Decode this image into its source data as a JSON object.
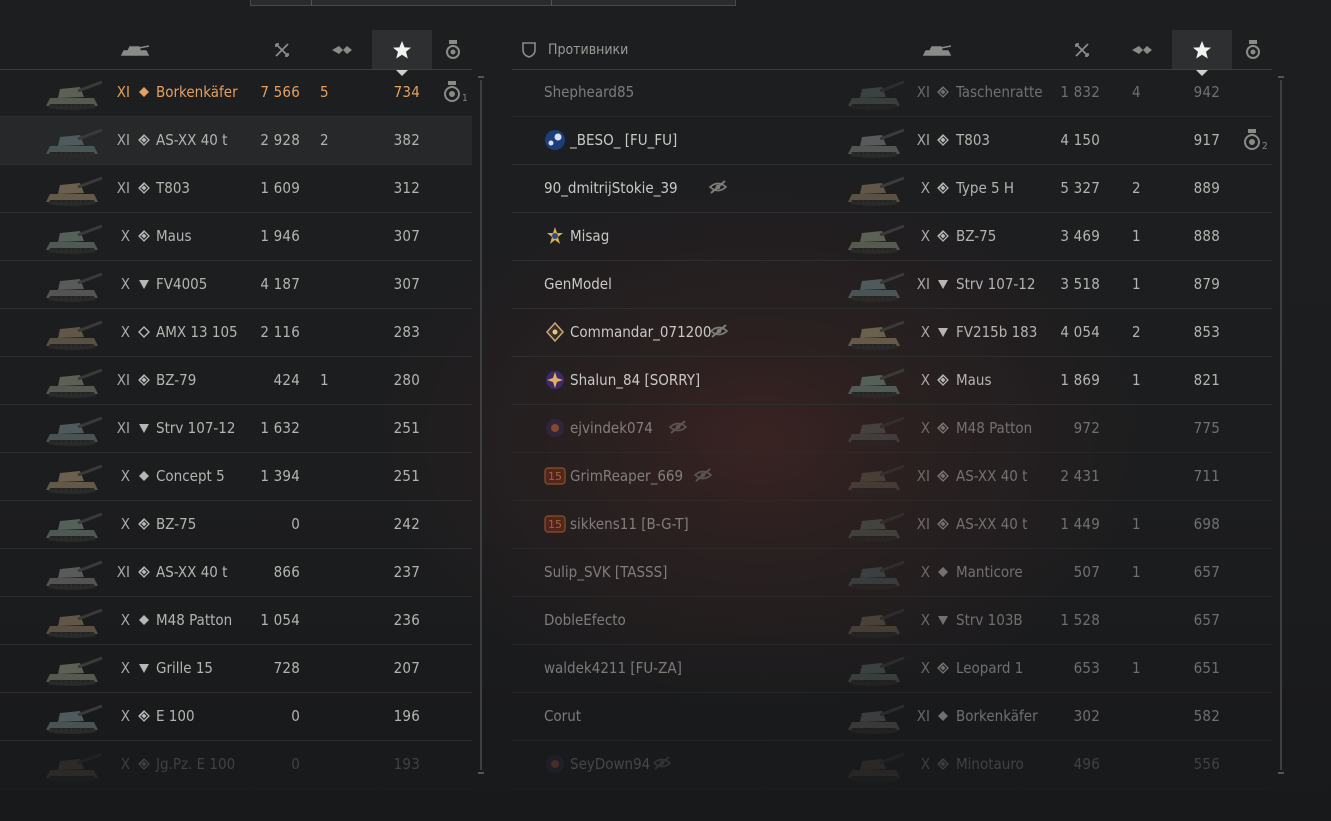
{
  "headers": {
    "enemies_label": "Противники",
    "cols": [
      "tank-icon",
      "frags-icon",
      "damage-icon",
      "xp-star-icon",
      "medal-icon"
    ]
  },
  "left_team": [
    {
      "tier": "XI",
      "cls": "med",
      "vehicle": "Borkenkäfer",
      "damage": "7 566",
      "frags": "5",
      "xp": "734",
      "medal": "1",
      "me": true
    },
    {
      "tier": "XI",
      "cls": "hvy",
      "vehicle": "AS-XX 40 t",
      "damage": "2 928",
      "frags": "2",
      "xp": "382",
      "hl": true
    },
    {
      "tier": "XI",
      "cls": "hvy",
      "vehicle": "T803",
      "damage": "1 609",
      "frags": "",
      "xp": "312"
    },
    {
      "tier": "X",
      "cls": "hvy",
      "vehicle": "Maus",
      "damage": "1 946",
      "frags": "",
      "xp": "307"
    },
    {
      "tier": "X",
      "cls": "td",
      "vehicle": "FV4005",
      "damage": "4 187",
      "frags": "",
      "xp": "307"
    },
    {
      "tier": "X",
      "cls": "lt",
      "vehicle": "AMX 13 105",
      "damage": "2 116",
      "frags": "",
      "xp": "283"
    },
    {
      "tier": "XI",
      "cls": "hvy",
      "vehicle": "BZ-79",
      "damage": "424",
      "frags": "1",
      "xp": "280"
    },
    {
      "tier": "XI",
      "cls": "td",
      "vehicle": "Strv 107-12",
      "damage": "1 632",
      "frags": "",
      "xp": "251"
    },
    {
      "tier": "X",
      "cls": "med",
      "vehicle": "Concept 5",
      "damage": "1 394",
      "frags": "",
      "xp": "251"
    },
    {
      "tier": "X",
      "cls": "hvy",
      "vehicle": "BZ-75",
      "damage": "0",
      "frags": "",
      "xp": "242"
    },
    {
      "tier": "XI",
      "cls": "hvy",
      "vehicle": "AS-XX 40 t",
      "damage": "866",
      "frags": "",
      "xp": "237"
    },
    {
      "tier": "X",
      "cls": "med",
      "vehicle": "M48 Patton",
      "damage": "1 054",
      "frags": "",
      "xp": "236"
    },
    {
      "tier": "X",
      "cls": "td",
      "vehicle": "Grille 15",
      "damage": "728",
      "frags": "",
      "xp": "207"
    },
    {
      "tier": "X",
      "cls": "hvy",
      "vehicle": "E 100",
      "damage": "0",
      "frags": "",
      "xp": "196"
    },
    {
      "tier": "X",
      "cls": "hvy",
      "vehicle": "Jg.Pz. E 100",
      "damage": "0",
      "frags": "",
      "xp": "193",
      "fade": 2
    }
  ],
  "right_team": [
    {
      "player": "Shepheard85",
      "tier": "XI",
      "cls": "hvy",
      "vehicle": "Taschenratte",
      "damage": "1 832",
      "frags": "4",
      "xp": "942",
      "fade": 1
    },
    {
      "player": "_BESO_ [FU_FU]",
      "badge": "steam",
      "tier": "XI",
      "cls": "hvy",
      "vehicle": "T803",
      "damage": "4 150",
      "frags": "",
      "xp": "917",
      "medal": "2"
    },
    {
      "player": "90_dmitrijStokie_39",
      "hidden": true,
      "tier": "X",
      "cls": "hvy",
      "vehicle": "Type 5 H",
      "damage": "5 327",
      "frags": "2",
      "xp": "889"
    },
    {
      "player": "Misag",
      "badge": "gold",
      "tier": "X",
      "cls": "hvy",
      "vehicle": "BZ-75",
      "damage": "3 469",
      "frags": "1",
      "xp": "888"
    },
    {
      "player": "GenModel",
      "tier": "XI",
      "cls": "td",
      "vehicle": "Strv 107-12",
      "damage": "3 518",
      "frags": "1",
      "xp": "879"
    },
    {
      "player": "Commandar_071200",
      "badge": "diamond",
      "hidden": true,
      "tier": "X",
      "cls": "td",
      "vehicle": "FV215b 183",
      "damage": "4 054",
      "frags": "2",
      "xp": "853"
    },
    {
      "player": "Shalun_84 [SORRY]",
      "badge": "purple",
      "tier": "X",
      "cls": "hvy",
      "vehicle": "Maus",
      "damage": "1 869",
      "frags": "1",
      "xp": "821"
    },
    {
      "player": "ejvindek074",
      "badge": "orb",
      "hidden": true,
      "tier": "X",
      "cls": "hvy",
      "vehicle": "M48 Patton",
      "damage": "972",
      "frags": "",
      "xp": "775",
      "fade": 1
    },
    {
      "player": "GrimReaper_669",
      "badge": "15",
      "hidden": true,
      "tier": "XI",
      "cls": "hvy",
      "vehicle": "AS-XX 40 t",
      "damage": "2 431",
      "frags": "",
      "xp": "711",
      "fade": 1
    },
    {
      "player": "sikkens11 [B-G-T]",
      "badge": "15",
      "tier": "XI",
      "cls": "hvy",
      "vehicle": "AS-XX 40 t",
      "damage": "1 449",
      "frags": "1",
      "xp": "698",
      "fade": 1
    },
    {
      "player": "Sulip_SVK [TASSS]",
      "tier": "X",
      "cls": "med",
      "vehicle": "Manticore",
      "damage": "507",
      "frags": "1",
      "xp": "657",
      "fade": 1
    },
    {
      "player": "DobleEfecto",
      "tier": "X",
      "cls": "td",
      "vehicle": "Strv 103B",
      "damage": "1 528",
      "frags": "",
      "xp": "657",
      "fade": 1
    },
    {
      "player": "waldek4211 [FU-ZA]",
      "tier": "X",
      "cls": "hvy",
      "vehicle": "Leopard 1",
      "damage": "653",
      "frags": "1",
      "xp": "651",
      "fade": 1
    },
    {
      "player": "Corut",
      "tier": "XI",
      "cls": "med",
      "vehicle": "Borkenkäfer",
      "damage": "302",
      "frags": "",
      "xp": "582",
      "fade": 1
    },
    {
      "player": "SeyDown94",
      "badge": "orb",
      "hidden": true,
      "tier": "X",
      "cls": "hvy",
      "vehicle": "Minotauro",
      "damage": "496",
      "frags": "",
      "xp": "556",
      "fade": 2
    }
  ]
}
